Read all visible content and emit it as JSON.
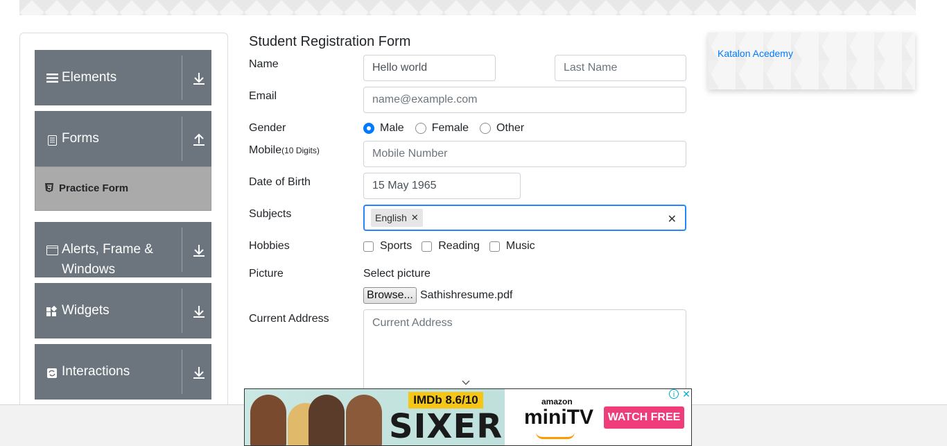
{
  "sidebar": {
    "groups": [
      {
        "label": "Elements",
        "icon": "hamburger-icon",
        "arrow": "down"
      },
      {
        "label": "Forms",
        "icon": "document-icon",
        "arrow": "up"
      },
      {
        "label": "Alerts, Frame &",
        "label2": "Windows",
        "icon": "window-icon",
        "arrow": "down"
      },
      {
        "label": "Widgets",
        "icon": "widgets-icon",
        "arrow": "down"
      },
      {
        "label": "Interactions",
        "icon": "interactions-icon",
        "arrow": "down"
      }
    ],
    "active_item": {
      "label": "Practice Form",
      "icon": "html5-icon"
    }
  },
  "form": {
    "title": "Student Registration Form",
    "name_label": "Name",
    "first_name_value": "Hello world",
    "last_name_placeholder": "Last Name",
    "email_label": "Email",
    "email_placeholder": "name@example.com",
    "gender_label": "Gender",
    "gender_options": [
      "Male",
      "Female",
      "Other"
    ],
    "gender_selected": "Male",
    "mobile_label": "Mobile",
    "mobile_hint": "(10 Digits)",
    "mobile_placeholder": "Mobile Number",
    "dob_label": "Date of Birth",
    "dob_value": "15 May 1965",
    "subjects_label": "Subjects",
    "subjects_chips": [
      "English"
    ],
    "hobbies_label": "Hobbies",
    "hobbies": [
      "Sports",
      "Reading",
      "Music"
    ],
    "picture_label": "Picture",
    "select_picture_label": "Select picture",
    "browse_label": "Browse...",
    "file_name": "Sathishresume.pdf",
    "address_label": "Current Address",
    "address_placeholder": "Current Address"
  },
  "right_ad": {
    "link_text": "Katalon Acedemy"
  },
  "bottom_ad": {
    "imdb_text": "IMDb 8.6/10",
    "title_text": "SIXER",
    "brand_top": "amazon",
    "brand_main": "miniTV",
    "cta": "WATCH FREE"
  },
  "colors": {
    "sidebar_header": "#6c757d",
    "active_item": "#aaaaaa",
    "accent": "#007bff",
    "focus_border": "#2684ff",
    "cta": "#ef3c7b"
  }
}
